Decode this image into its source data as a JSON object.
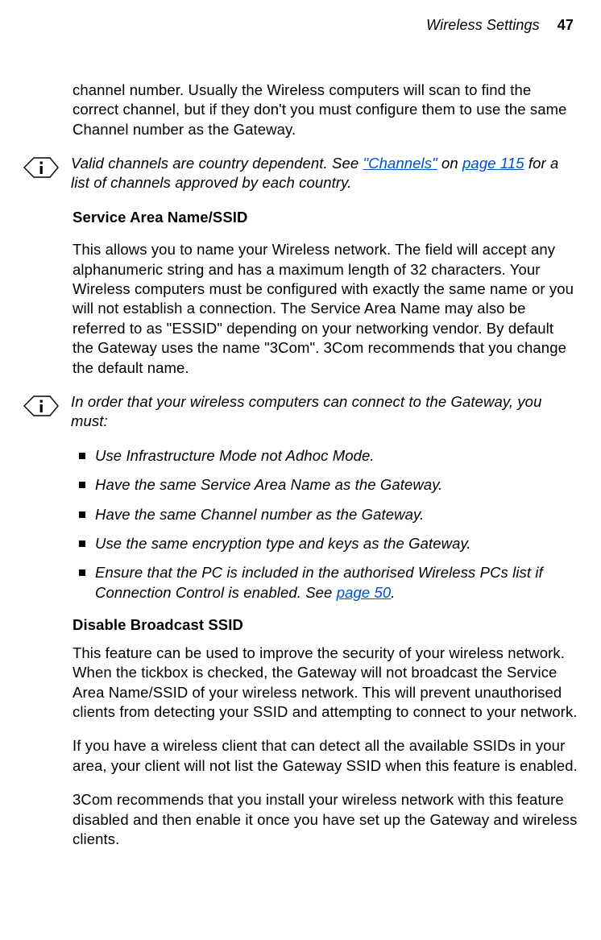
{
  "header": {
    "title": "Wireless Settings",
    "page": "47"
  },
  "p1": "channel number. Usually the Wireless computers will scan to find the correct channel, but if they don't you must configure them to use the same Channel number as the Gateway.",
  "note1": {
    "pre": "Valid channels are country dependent. See ",
    "link1": "\"Channels\"",
    "mid": " on ",
    "link2": "page 115",
    "post": " for a list of channels approved by each country."
  },
  "h1": "Service Area Name/SSID",
  "p2": "This allows you to name your Wireless network. The field will accept any alphanumeric string and has a maximum length of 32 characters. Your Wireless computers must be configured with exactly the same name or you will not establish a connection. The Service Area Name may also be referred to as \"ESSID\" depending on your networking vendor. By default the Gateway uses the name \"3Com\". 3Com recommends that you change the default name.",
  "note2_intro": "In order that your wireless computers can connect to the Gateway, you must:",
  "reqs": {
    "r1": "Use Infrastructure Mode not Adhoc Mode.",
    "r2": "Have the same Service Area Name as the Gateway.",
    "r3": "Have the same Channel number as the Gateway.",
    "r4": "Use the same encryption type and keys as the Gateway.",
    "r5_pre": "Ensure that the PC is included in the authorised Wireless PCs list if Connection Control is enabled. See ",
    "r5_link": "page 50",
    "r5_post": "."
  },
  "h2": "Disable Broadcast SSID",
  "p3": "This feature can be used to improve the security of your wireless network. When the tickbox is checked, the Gateway will not broadcast the Service Area Name/SSID of your wireless network. This will prevent unauthorised clients from detecting your SSID and attempting to connect to your network.",
  "p4": "If you have a wireless client that can detect all the available SSIDs in your area, your client will not list the Gateway SSID when this feature is enabled.",
  "p5": "3Com recommends that you install your wireless network with this feature disabled and then enable it once you have set up the Gateway and wireless clients."
}
